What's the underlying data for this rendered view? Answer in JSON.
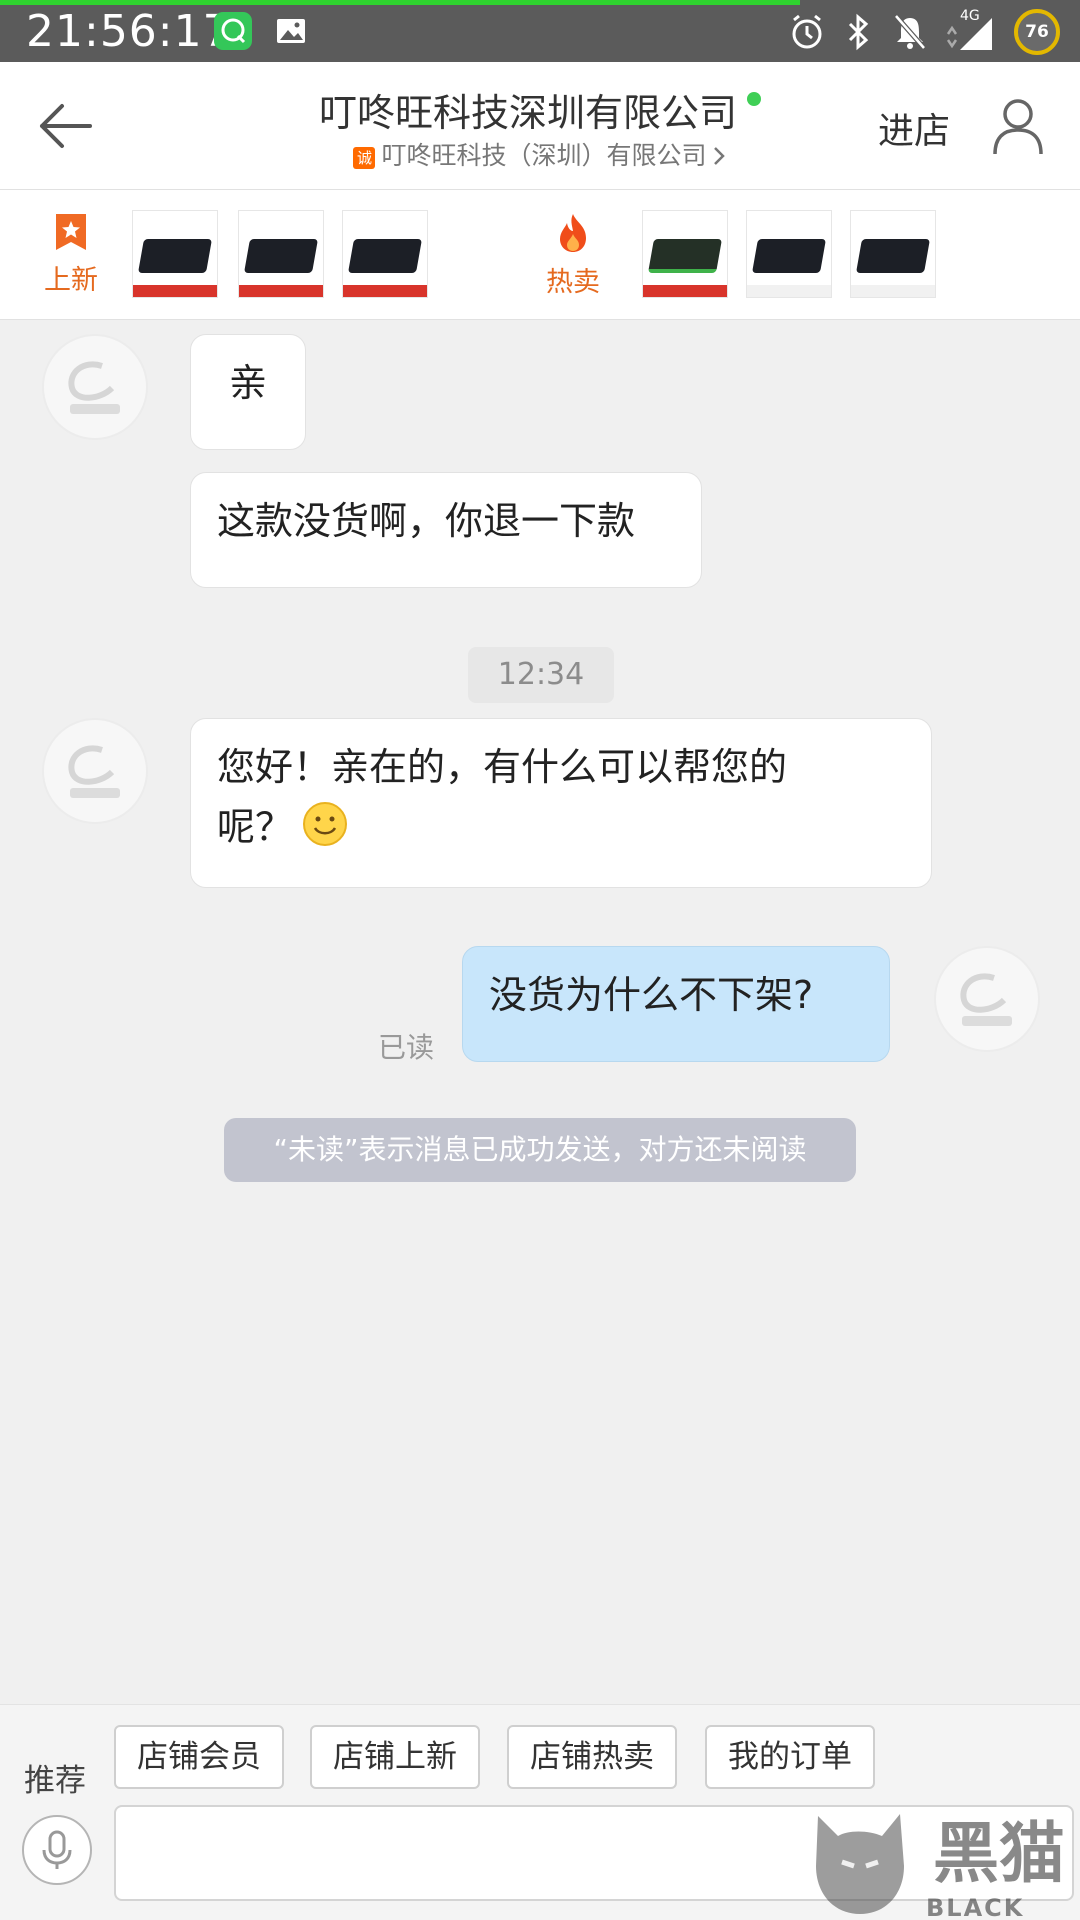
{
  "status_bar": {
    "time": "21:56:17",
    "network": "4G",
    "battery": "76"
  },
  "header": {
    "title": "叮咚旺科技深圳有限公司",
    "cheng_badge": "诚",
    "subtitle": "叮咚旺科技（深圳）有限公司",
    "enter_shop": "进店"
  },
  "product_strip": {
    "new_label": "上新",
    "hot_label": "热卖"
  },
  "messages": [
    {
      "from": "shop",
      "text": "亲"
    },
    {
      "from": "shop",
      "text": "这款没货啊，你退一下款"
    },
    {
      "from": "shop",
      "line1": "您好！亲在的，有什么可以帮您的",
      "line2": "呢？"
    },
    {
      "from": "me",
      "text": "没货为什么不下架?"
    }
  ],
  "timestamp": "12:34",
  "read_status": "已读",
  "notice": "“未读”表示消息已成功发送，对方还未阅读",
  "bottom_bar": {
    "recommend_label": "推荐",
    "chips": [
      "店铺会员",
      "店铺上新",
      "店铺热卖",
      "我的订单"
    ],
    "input_value": ""
  },
  "watermark": {
    "brand": "黑猫",
    "brand_en": "BLACK CAT"
  },
  "colors": {
    "status_bar": "#5b5b5b",
    "accent_orange": "#e56a1f",
    "self_bubble": "#c8e6fb",
    "online_dot": "#3fcf56",
    "notice_bg": "#c2c4cf"
  }
}
